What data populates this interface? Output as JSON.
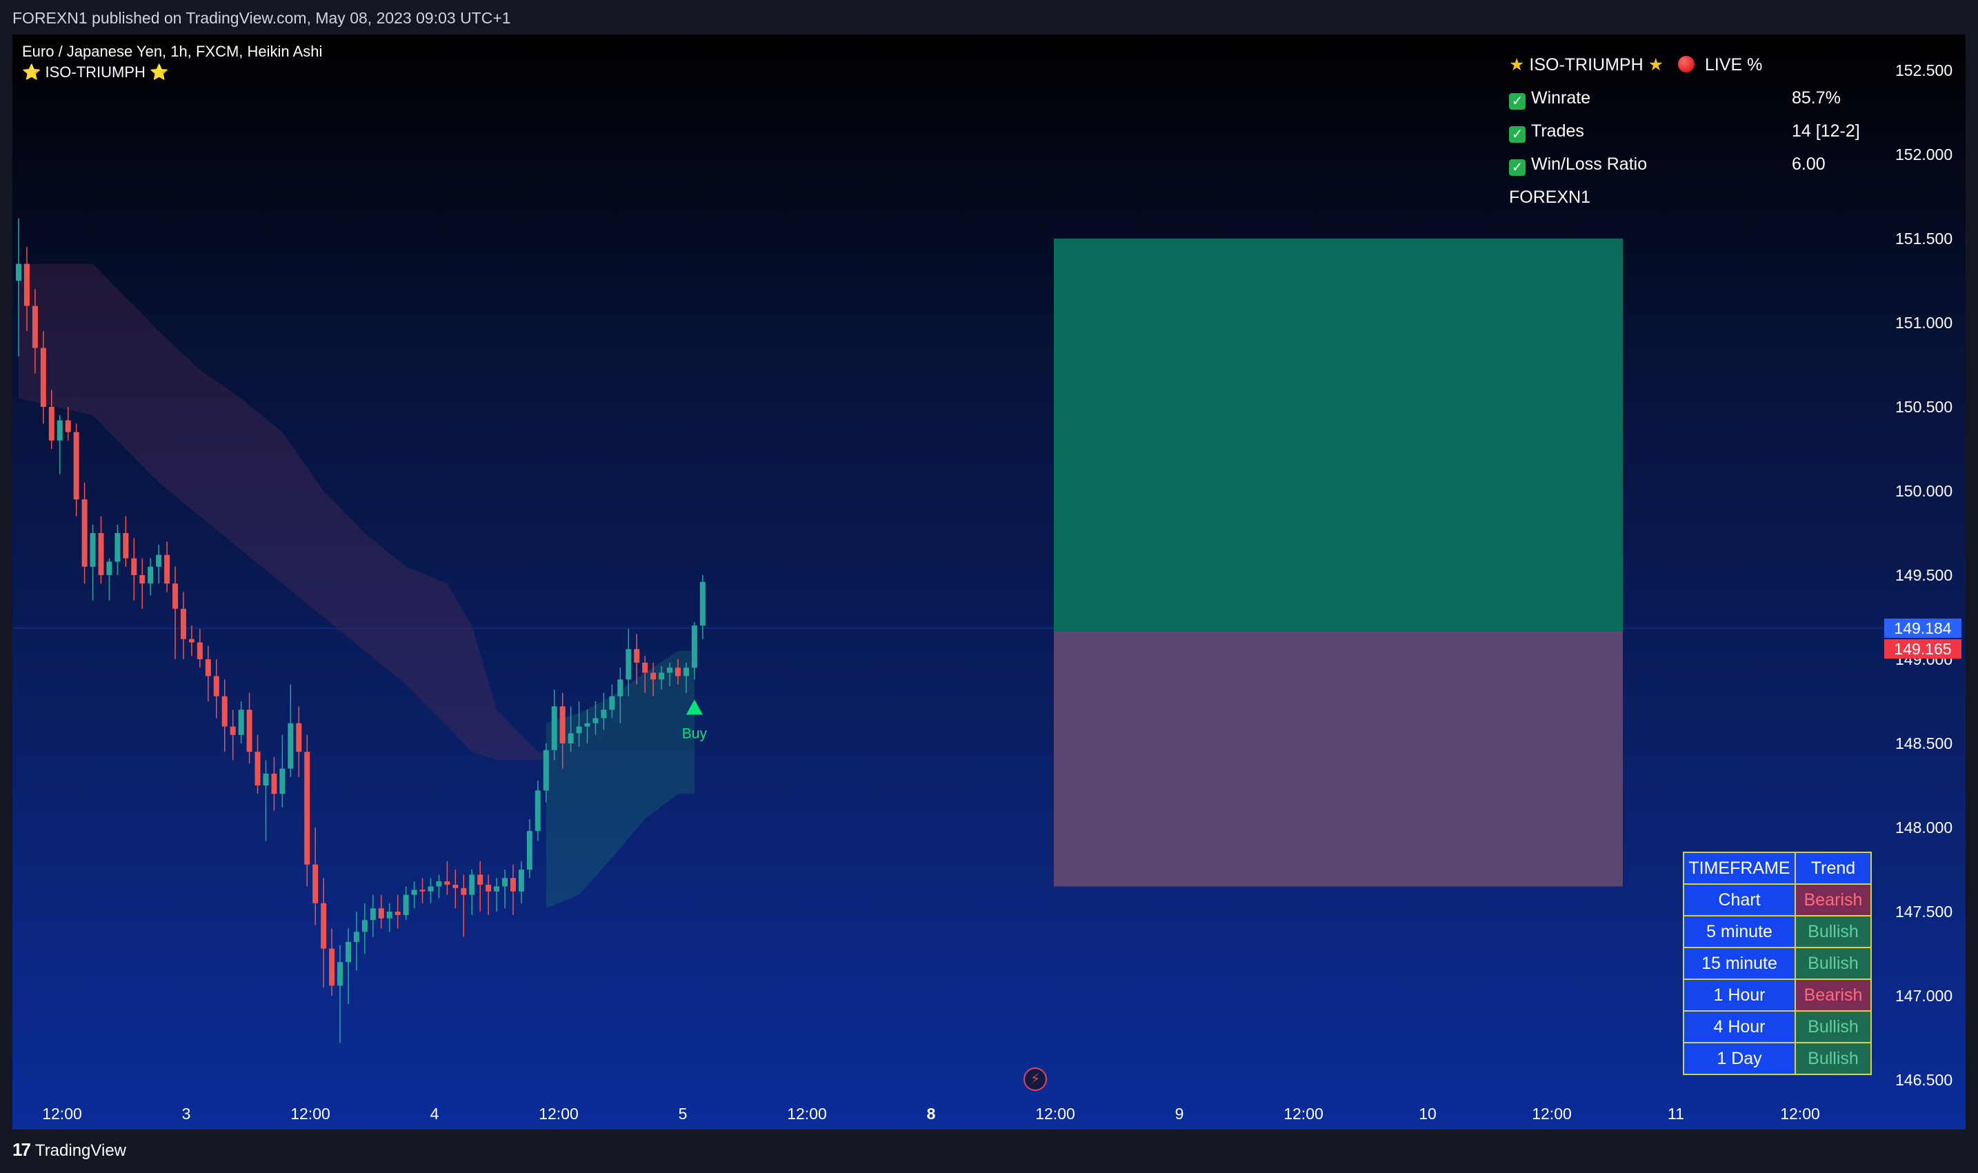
{
  "header": {
    "published_text": "FOREXN1 published on TradingView.com, May 08, 2023 09:03 UTC+1"
  },
  "legend": {
    "symbol_line": "Euro / Japanese Yen, 1h, FXCM, Heikin Ashi",
    "indicator_line": "⭐ ISO-TRIUMPH ⭐"
  },
  "stats_panel": {
    "title": "ISO-TRIUMPH",
    "live_label": "LIVE %",
    "rows": [
      {
        "label": "Winrate",
        "value": "85.7%"
      },
      {
        "label": "Trades",
        "value": "14 [12-2]"
      },
      {
        "label": "Win/Loss Ratio",
        "value": "6.00"
      }
    ],
    "author": "FOREXN1"
  },
  "trend_table": {
    "headers": [
      "TIMEFRAME",
      "Trend"
    ],
    "rows": [
      {
        "timeframe": "Chart",
        "trend": "Bearish"
      },
      {
        "timeframe": "5 minute",
        "trend": "Bullish"
      },
      {
        "timeframe": "15 minute",
        "trend": "Bullish"
      },
      {
        "timeframe": "1 Hour",
        "trend": "Bearish"
      },
      {
        "timeframe": "4 Hour",
        "trend": "Bullish"
      },
      {
        "timeframe": "1 Day",
        "trend": "Bullish"
      }
    ]
  },
  "price_tags": {
    "last_price": "149.184",
    "entry_price": "149.165"
  },
  "footer": {
    "brand": "TradingView"
  },
  "chart_data": {
    "type": "candlestick",
    "symbol": "EURJPY",
    "interval": "1h",
    "style": "Heikin Ashi",
    "ylim": [
      146.3,
      152.75
    ],
    "y_ticks": [
      "146.500",
      "147.000",
      "147.500",
      "148.000",
      "148.500",
      "149.000",
      "149.500",
      "150.000",
      "150.500",
      "151.000",
      "151.500",
      "152.000",
      "152.500"
    ],
    "x_ticks": [
      "12:00",
      "3",
      "12:00",
      "4",
      "12:00",
      "5",
      "12:00",
      "8",
      "12:00",
      "9",
      "12:00",
      "10",
      "12:00",
      "11",
      "12:00"
    ],
    "x_ticks_bold": [
      "8"
    ],
    "candles": [
      {
        "o": 151.25,
        "h": 151.62,
        "l": 150.8,
        "c": 151.35
      },
      {
        "o": 151.35,
        "h": 151.45,
        "l": 150.95,
        "c": 151.1
      },
      {
        "o": 151.1,
        "h": 151.2,
        "l": 150.7,
        "c": 150.85
      },
      {
        "o": 150.85,
        "h": 150.95,
        "l": 150.4,
        "c": 150.5
      },
      {
        "o": 150.5,
        "h": 150.6,
        "l": 150.25,
        "c": 150.3
      },
      {
        "o": 150.3,
        "h": 150.45,
        "l": 150.1,
        "c": 150.42
      },
      {
        "o": 150.42,
        "h": 150.5,
        "l": 150.3,
        "c": 150.35
      },
      {
        "o": 150.35,
        "h": 150.4,
        "l": 149.85,
        "c": 149.95
      },
      {
        "o": 149.95,
        "h": 150.05,
        "l": 149.45,
        "c": 149.55
      },
      {
        "o": 149.55,
        "h": 149.8,
        "l": 149.35,
        "c": 149.75
      },
      {
        "o": 149.75,
        "h": 149.85,
        "l": 149.45,
        "c": 149.5
      },
      {
        "o": 149.5,
        "h": 149.6,
        "l": 149.35,
        "c": 149.58
      },
      {
        "o": 149.58,
        "h": 149.8,
        "l": 149.5,
        "c": 149.75
      },
      {
        "o": 149.75,
        "h": 149.85,
        "l": 149.55,
        "c": 149.6
      },
      {
        "o": 149.6,
        "h": 149.72,
        "l": 149.35,
        "c": 149.5
      },
      {
        "o": 149.5,
        "h": 149.6,
        "l": 149.3,
        "c": 149.45
      },
      {
        "o": 149.45,
        "h": 149.6,
        "l": 149.38,
        "c": 149.55
      },
      {
        "o": 149.55,
        "h": 149.68,
        "l": 149.45,
        "c": 149.62
      },
      {
        "o": 149.62,
        "h": 149.7,
        "l": 149.4,
        "c": 149.45
      },
      {
        "o": 149.45,
        "h": 149.55,
        "l": 149.0,
        "c": 149.3
      },
      {
        "o": 149.3,
        "h": 149.4,
        "l": 149.0,
        "c": 149.12
      },
      {
        "o": 149.12,
        "h": 149.2,
        "l": 149.02,
        "c": 149.1
      },
      {
        "o": 149.1,
        "h": 149.18,
        "l": 148.95,
        "c": 149.0
      },
      {
        "o": 149.0,
        "h": 149.08,
        "l": 148.75,
        "c": 148.9
      },
      {
        "o": 148.9,
        "h": 149.0,
        "l": 148.65,
        "c": 148.78
      },
      {
        "o": 148.78,
        "h": 148.88,
        "l": 148.45,
        "c": 148.6
      },
      {
        "o": 148.6,
        "h": 148.7,
        "l": 148.4,
        "c": 148.55
      },
      {
        "o": 148.55,
        "h": 148.75,
        "l": 148.5,
        "c": 148.7
      },
      {
        "o": 148.7,
        "h": 148.8,
        "l": 148.38,
        "c": 148.45
      },
      {
        "o": 148.45,
        "h": 148.55,
        "l": 148.2,
        "c": 148.25
      },
      {
        "o": 148.25,
        "h": 148.4,
        "l": 147.92,
        "c": 148.32
      },
      {
        "o": 148.32,
        "h": 148.42,
        "l": 148.1,
        "c": 148.2
      },
      {
        "o": 148.2,
        "h": 148.55,
        "l": 148.12,
        "c": 148.35
      },
      {
        "o": 148.35,
        "h": 148.85,
        "l": 148.3,
        "c": 148.62
      },
      {
        "o": 148.62,
        "h": 148.72,
        "l": 148.3,
        "c": 148.45
      },
      {
        "o": 148.45,
        "h": 148.55,
        "l": 147.65,
        "c": 147.78
      },
      {
        "o": 147.78,
        "h": 148.0,
        "l": 147.42,
        "c": 147.55
      },
      {
        "o": 147.55,
        "h": 147.7,
        "l": 147.05,
        "c": 147.28
      },
      {
        "o": 147.28,
        "h": 147.4,
        "l": 147.0,
        "c": 147.06
      },
      {
        "o": 147.06,
        "h": 147.3,
        "l": 146.72,
        "c": 147.2
      },
      {
        "o": 147.2,
        "h": 147.4,
        "l": 146.95,
        "c": 147.32
      },
      {
        "o": 147.32,
        "h": 147.5,
        "l": 147.15,
        "c": 147.38
      },
      {
        "o": 147.38,
        "h": 147.55,
        "l": 147.25,
        "c": 147.45
      },
      {
        "o": 147.45,
        "h": 147.6,
        "l": 147.35,
        "c": 147.52
      },
      {
        "o": 147.52,
        "h": 147.6,
        "l": 147.4,
        "c": 147.46
      },
      {
        "o": 147.46,
        "h": 147.55,
        "l": 147.38,
        "c": 147.5
      },
      {
        "o": 147.5,
        "h": 147.6,
        "l": 147.4,
        "c": 147.48
      },
      {
        "o": 147.48,
        "h": 147.65,
        "l": 147.45,
        "c": 147.6
      },
      {
        "o": 147.6,
        "h": 147.68,
        "l": 147.52,
        "c": 147.63
      },
      {
        "o": 147.63,
        "h": 147.7,
        "l": 147.55,
        "c": 147.62
      },
      {
        "o": 147.62,
        "h": 147.7,
        "l": 147.55,
        "c": 147.65
      },
      {
        "o": 147.65,
        "h": 147.72,
        "l": 147.58,
        "c": 147.68
      },
      {
        "o": 147.68,
        "h": 147.8,
        "l": 147.6,
        "c": 147.66
      },
      {
        "o": 147.66,
        "h": 147.75,
        "l": 147.52,
        "c": 147.64
      },
      {
        "o": 147.64,
        "h": 147.72,
        "l": 147.35,
        "c": 147.6
      },
      {
        "o": 147.6,
        "h": 147.75,
        "l": 147.48,
        "c": 147.72
      },
      {
        "o": 147.72,
        "h": 147.8,
        "l": 147.5,
        "c": 147.66
      },
      {
        "o": 147.66,
        "h": 147.72,
        "l": 147.48,
        "c": 147.62
      },
      {
        "o": 147.62,
        "h": 147.7,
        "l": 147.5,
        "c": 147.65
      },
      {
        "o": 147.65,
        "h": 147.75,
        "l": 147.52,
        "c": 147.7
      },
      {
        "o": 147.7,
        "h": 147.78,
        "l": 147.48,
        "c": 147.62
      },
      {
        "o": 147.62,
        "h": 147.8,
        "l": 147.55,
        "c": 147.75
      },
      {
        "o": 147.75,
        "h": 148.05,
        "l": 147.7,
        "c": 147.98
      },
      {
        "o": 147.98,
        "h": 148.28,
        "l": 147.92,
        "c": 148.22
      },
      {
        "o": 148.22,
        "h": 148.5,
        "l": 148.15,
        "c": 148.46
      },
      {
        "o": 148.46,
        "h": 148.82,
        "l": 148.4,
        "c": 148.72
      },
      {
        "o": 148.72,
        "h": 148.8,
        "l": 148.35,
        "c": 148.5
      },
      {
        "o": 148.5,
        "h": 148.72,
        "l": 148.45,
        "c": 148.56
      },
      {
        "o": 148.56,
        "h": 148.75,
        "l": 148.48,
        "c": 148.6
      },
      {
        "o": 148.6,
        "h": 148.7,
        "l": 148.5,
        "c": 148.62
      },
      {
        "o": 148.62,
        "h": 148.75,
        "l": 148.55,
        "c": 148.65
      },
      {
        "o": 148.65,
        "h": 148.8,
        "l": 148.58,
        "c": 148.7
      },
      {
        "o": 148.7,
        "h": 148.85,
        "l": 148.65,
        "c": 148.78
      },
      {
        "o": 148.78,
        "h": 148.95,
        "l": 148.62,
        "c": 148.88
      },
      {
        "o": 148.88,
        "h": 149.18,
        "l": 148.78,
        "c": 149.06
      },
      {
        "o": 149.06,
        "h": 149.15,
        "l": 148.85,
        "c": 148.98
      },
      {
        "o": 148.98,
        "h": 149.02,
        "l": 148.8,
        "c": 148.92
      },
      {
        "o": 148.92,
        "h": 148.98,
        "l": 148.78,
        "c": 148.88
      },
      {
        "o": 148.88,
        "h": 148.96,
        "l": 148.82,
        "c": 148.92
      },
      {
        "o": 148.92,
        "h": 148.98,
        "l": 148.84,
        "c": 148.95
      },
      {
        "o": 148.95,
        "h": 149.0,
        "l": 148.85,
        "c": 148.9
      },
      {
        "o": 148.9,
        "h": 148.98,
        "l": 148.8,
        "c": 148.95
      },
      {
        "o": 148.95,
        "h": 149.22,
        "l": 148.88,
        "c": 149.2
      },
      {
        "o": 149.2,
        "h": 149.5,
        "l": 149.12,
        "c": 149.46
      }
    ],
    "cloud_bearish": [
      [
        0,
        151.35,
        150.55
      ],
      [
        9,
        151.35,
        150.45
      ],
      [
        12,
        151.2,
        150.3
      ],
      [
        17,
        150.95,
        150.05
      ],
      [
        22,
        150.72,
        149.85
      ],
      [
        27,
        150.55,
        149.65
      ],
      [
        32,
        150.35,
        149.45
      ],
      [
        37,
        150.0,
        149.25
      ],
      [
        42,
        149.75,
        149.05
      ],
      [
        47,
        149.55,
        148.85
      ],
      [
        52,
        149.45,
        148.6
      ],
      [
        55,
        149.2,
        148.45
      ],
      [
        58,
        148.7,
        148.4
      ],
      [
        63,
        148.45,
        148.4
      ],
      [
        64,
        148.45,
        148.4
      ]
    ],
    "cloud_bullish": [
      [
        64,
        148.62,
        147.52
      ],
      [
        68,
        148.68,
        147.6
      ],
      [
        72,
        148.78,
        147.82
      ],
      [
        76,
        148.92,
        148.05
      ],
      [
        80,
        149.05,
        148.2
      ],
      [
        82,
        149.05,
        148.2
      ]
    ],
    "signals": [
      {
        "index": 82,
        "type": "Buy",
        "price": 148.72
      }
    ],
    "position": {
      "entry": 149.165,
      "target": 151.5,
      "stop": 147.65,
      "start_index": 84,
      "end_index": 125
    },
    "colors": {
      "bull": "#26a69a",
      "bear": "#ef5350",
      "profit_zone": "#0a6b5a",
      "loss_zone": "#5c4672",
      "last_tag": "#2962ff",
      "entry_tag": "#f23645",
      "signal": "#00e676"
    }
  }
}
